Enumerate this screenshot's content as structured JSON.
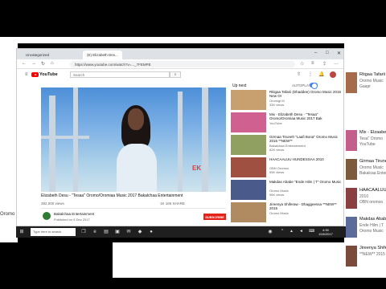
{
  "background": {
    "left_text": "Oromo",
    "right_items": [
      {
        "t1": "Rtigaa Tafarii",
        "t2": "Oromo Music",
        "t3": "Gaapr",
        "color": "#a56b4a"
      },
      {
        "t1": "",
        "t2": "",
        "t3": "",
        "color": "#ffffff"
      },
      {
        "t1": "Mix - Elzaabeth",
        "t2": "Tesa\" Oromo",
        "t3": "YouTube",
        "color": "#c45e8a"
      },
      {
        "t1": "Girmaa Tiruneh",
        "t2": "Oromo Music",
        "t3": "Bakalcaa Enterta",
        "color": "#7d5a3c"
      },
      {
        "t1": "HAACAALUU",
        "t2": "2010",
        "t3": "OBN oromoo",
        "color": "#8a4040"
      },
      {
        "t1": "Makdas Ababe",
        "t2": "Ende Hilm | T",
        "t3": "Oromo Music",
        "color": "#5b6b9a"
      },
      {
        "t1": "Jireenya Shiferaw",
        "t2": "**NEW** 2015",
        "t3": "",
        "color": "#7a4a3a"
      }
    ]
  },
  "browser": {
    "tabs": [
      {
        "label": "Uncategorized",
        "active": false
      },
      {
        "label": "(E) Elizabeth Des...",
        "active": true
      }
    ],
    "url": "https://www.youtube.com/watch?v=..._7FEMPE"
  },
  "youtube": {
    "logo": "YouTube",
    "search_placeholder": "Search",
    "video_title": "Elizabeth Desu - \"Tesaa\" Oromo/Oromiaa Music 2017 Bakalchaa Entertainment",
    "views": "382,000 views",
    "actions": "1K  165  SHARE",
    "channel": "Bakalchaa Entertainment",
    "published": "Published on 5 Dec 2017",
    "subscribe": "SUBSCRIBE",
    "watermark": "EK",
    "up_next": "Up next",
    "autoplay": "AUTOPLAY",
    "recommendations": [
      {
        "title": "Ritigaa Tafarii (Dhaddee) Oromo Music 2016 New Or",
        "channel": "Oromigt M",
        "views": "33K views",
        "color": "#c8a070"
      },
      {
        "title": "Mix - Elizabeth Desu - \"Tesaa\" Oromo/Oromiaa Music 2017 Bak",
        "channel": "YouTube",
        "views": "",
        "color": "#d06090"
      },
      {
        "title": "Girmaa Tiruneh \"Laafi Bona\" Oromo Music 2016 **NEW**",
        "channel": "Bakalchaa Entertainment",
        "views": "82K views",
        "color": "#8fa060"
      },
      {
        "title": "HAACAALUU HUNDESSAA 2010",
        "channel": "OBN Oromoo",
        "views": "55K views",
        "color": "#a05040"
      },
      {
        "title": "Makdas Ababe \"Ende Hilm | T\" Oromo Music",
        "channel": "Oromo Music",
        "views": "96K views",
        "color": "#4a5a8a"
      },
      {
        "title": "Jireenya Shiferaw - Dhaggeessa **NEW** 2015",
        "channel": "Oromo Music",
        "views": "",
        "color": "#b08a60"
      }
    ]
  },
  "taskbar": {
    "search_text": "Type here to search",
    "time": "4:39",
    "date": "12/6/2017"
  }
}
